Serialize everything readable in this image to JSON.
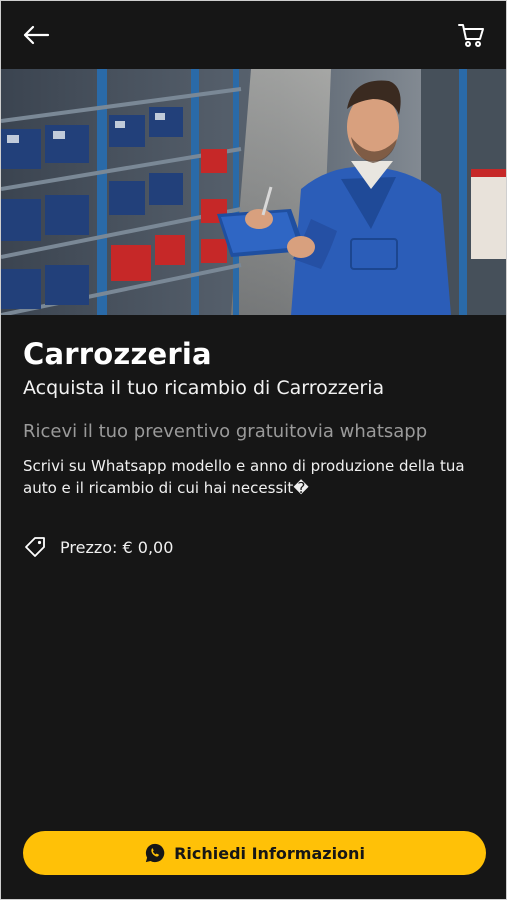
{
  "header": {
    "back_icon": "arrow-left-icon",
    "cart_icon": "cart-icon"
  },
  "product": {
    "title": "Carrozzeria",
    "subtitle": "Acquista il tuo ricambio di Carrozzeria",
    "tagline": "Ricevi il tuo preventivo gratuitovia whatsapp",
    "description": "Scrivi su Whatsapp modello e anno di produzione della tua auto e il ricambio di cui hai necessit�",
    "price_label": "Prezzo: € 0,00"
  },
  "cta": {
    "label": "Richiedi Informazioni",
    "icon": "whatsapp-icon",
    "color": "#ffc107"
  },
  "colors": {
    "background": "#161616",
    "accent": "#ffc107",
    "muted": "#9a9a9a"
  }
}
